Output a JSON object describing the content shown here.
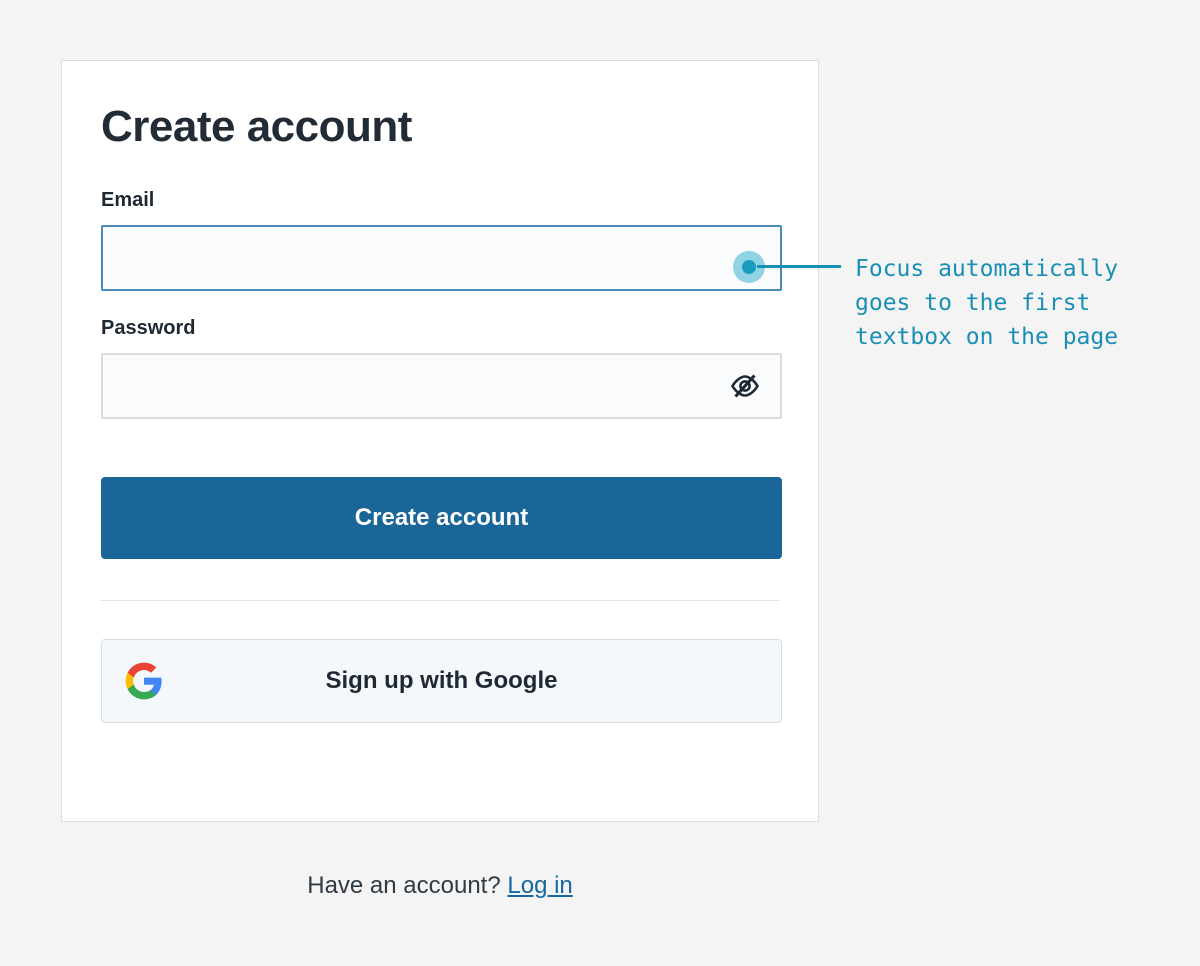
{
  "page": {
    "background_color": "#f4f4f4"
  },
  "card": {
    "title": "Create account",
    "fields": [
      {
        "id": "email",
        "label": "Email",
        "value": "",
        "placeholder": "",
        "focused": true,
        "type": "email"
      },
      {
        "id": "password",
        "label": "Password",
        "value": "",
        "placeholder": "",
        "focused": false,
        "type": "password",
        "trailing_icon": "eye-off-icon"
      }
    ],
    "submit_button": {
      "label": "Create account",
      "color": "#1b6699",
      "text_color": "#ffffff"
    },
    "social": {
      "google_label": "Sign up with Google",
      "icon": "google-g-icon"
    }
  },
  "footer": {
    "prompt": "Have an account?",
    "link_label": "Log in",
    "link_color": "#15699f"
  },
  "annotation": {
    "text": "Focus automatically\ngoes to the first\ntextbox on the page",
    "color": "#1a8fb5",
    "marker": "focus-dot",
    "marker_halo_color": "#8fd3e4",
    "marker_core_color": "#1a9cc0"
  }
}
